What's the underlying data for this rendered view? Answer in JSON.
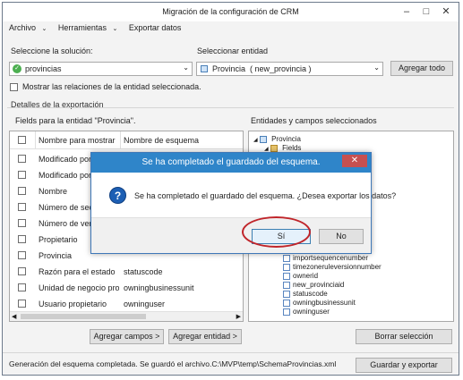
{
  "window": {
    "title": "Migración de la configuración de CRM"
  },
  "menu": [
    "Archivo",
    "Herramientas",
    "Exportar datos"
  ],
  "solution": {
    "label": "Seleccione la solución:",
    "value": "provincias"
  },
  "entity": {
    "label": "Seleccionar entidad",
    "value": "Provincia  ( new_provincia )"
  },
  "buttons": {
    "add_all": "Agregar todo",
    "add_fields": "Agregar campos >",
    "add_entity": "Agregar entidad >",
    "clear_selection": "Borrar selección",
    "save_export": "Guardar y exportar"
  },
  "show_relations": "Mostrar las relaciones de la entidad seleccionada.",
  "export_details": "Detalles de la exportación",
  "fields_label": "Fields  para la entidad \"Provincia\".",
  "table": {
    "headers": [
      "Nombre para mostrar",
      "Nombre de esquema"
    ],
    "rows": [
      [
        "Modificado por",
        ""
      ],
      [
        "Modificado por (d",
        ""
      ],
      [
        "Nombre",
        ""
      ],
      [
        "Número de secuen",
        ""
      ],
      [
        "Número de versión",
        ""
      ],
      [
        "Propietario",
        ""
      ],
      [
        "Provincia",
        ""
      ],
      [
        "Razón para el estado",
        "statuscode"
      ],
      [
        "Unidad de negocio propie",
        "owningbusinessunit"
      ],
      [
        "Usuario propietario",
        "owninguser"
      ]
    ]
  },
  "selected_label": "Entidades y campos seleccionados",
  "tree": {
    "root": "Provincia",
    "folder": "Fields",
    "visible_fields": [
      "importsequencenumber",
      "timezoneruleversionnumber",
      "ownerid",
      "new_provinciaid",
      "statuscode",
      "owningbusinessunit",
      "owninguser"
    ]
  },
  "status": "Generación del esquema completada. Se guardó el archivo.C:\\MVP\\temp\\SchemaProvincias.xml",
  "dialog": {
    "title": "Se ha completado el guardado del esquema.",
    "message": "Se ha completado el guardado del esquema. ¿Desea exportar los datos?",
    "yes": "Sí",
    "no": "No"
  },
  "colors": {
    "dialog_title_bar": "#2f85c9",
    "highlight_ring": "#c0252a"
  }
}
